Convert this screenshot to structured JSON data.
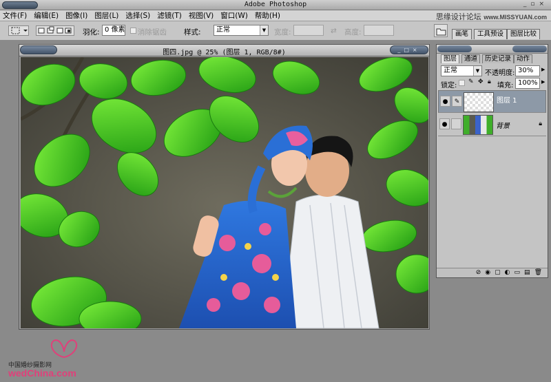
{
  "app": {
    "title": "Adobe Photoshop"
  },
  "watermark": {
    "site_cn": "思缘设计论坛",
    "site_en": "www.MISSYUAN.com"
  },
  "menu": [
    "文件(F)",
    "编辑(E)",
    "图像(I)",
    "图层(L)",
    "选择(S)",
    "滤镜(T)",
    "视图(V)",
    "窗口(W)",
    "帮助(H)"
  ],
  "options": {
    "feather_label": "羽化:",
    "feather_value": "0 像素",
    "antialias_label": "消除锯齿",
    "style_label": "样式:",
    "style_value": "正常",
    "width_label": "宽度:",
    "height_label": "高度:"
  },
  "palette_well": {
    "tabs": [
      "画笔",
      "工具预设",
      "图层比较"
    ]
  },
  "document": {
    "title": "图四.jpg @ 25% (图层 1, RGB/8#)"
  },
  "layers_panel": {
    "tabs": [
      "图层",
      "通道",
      "历史记录",
      "动作"
    ],
    "blend_mode": "正常",
    "opacity_label": "不透明度:",
    "opacity_value": "30%",
    "lock_label": "锁定:",
    "fill_label": "填充:",
    "fill_value": "100%",
    "layers": [
      {
        "name": "图层 1",
        "selected": true
      },
      {
        "name": "背景",
        "selected": false
      }
    ]
  },
  "logo": {
    "cn": "中国婚纱摄影网",
    "en": "wedChina.com"
  },
  "icons": {
    "marquee": "rect-marquee-icon",
    "eye": "eye-icon",
    "brush": "brush-icon",
    "lock": "lock-icon",
    "swap": "swap-arrows-icon"
  }
}
